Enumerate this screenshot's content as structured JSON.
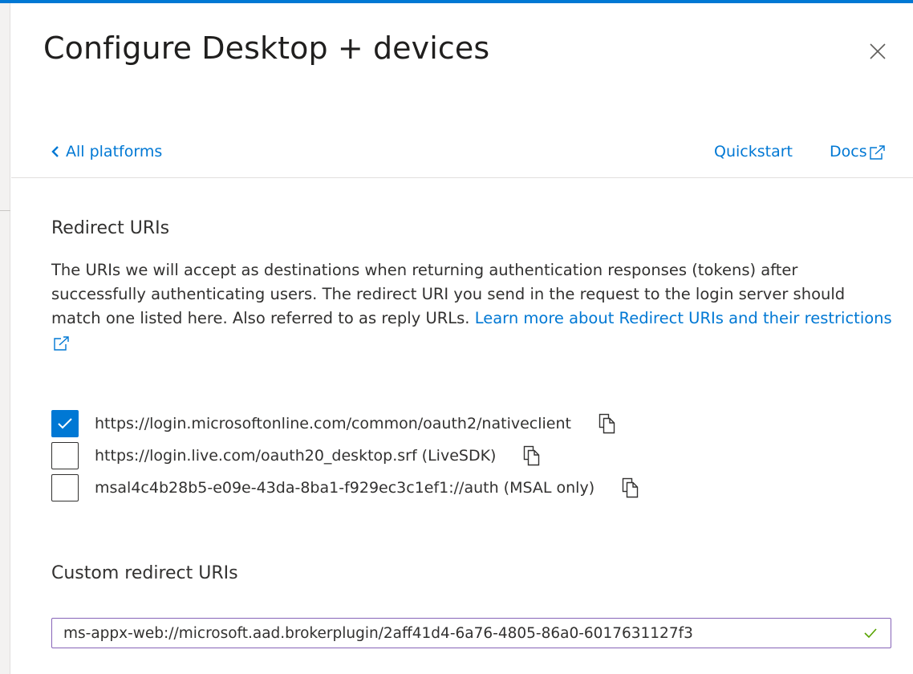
{
  "panel": {
    "title": "Configure Desktop + devices",
    "close_icon": "close-icon"
  },
  "nav": {
    "back_label": "All platforms",
    "quickstart_label": "Quickstart",
    "docs_label": "Docs"
  },
  "redirect": {
    "title": "Redirect URIs",
    "description": "The URIs we will accept as destinations when returning authentication responses (tokens) after successfully authenticating users. The redirect URI you send in the request to the login server should match one listed here. Also referred to as reply URLs. ",
    "learn_more": "Learn more about Redirect URIs and their restrictions",
    "uris": [
      {
        "label": "https://login.microsoftonline.com/common/oauth2/nativeclient",
        "checked": true
      },
      {
        "label": "https://login.live.com/oauth20_desktop.srf (LiveSDK)",
        "checked": false
      },
      {
        "label": "msal4c4b28b5-e09e-43da-8ba1-f929ec3c1ef1://auth (MSAL only)",
        "checked": false
      }
    ]
  },
  "custom": {
    "title": "Custom redirect URIs",
    "value": "ms-appx-web://microsoft.aad.brokerplugin/2aff41d4-6a76-4805-86a0-6017631127f3"
  },
  "colors": {
    "accent": "#0078d4",
    "input_border": "#8764b8",
    "valid": "#57a300"
  }
}
